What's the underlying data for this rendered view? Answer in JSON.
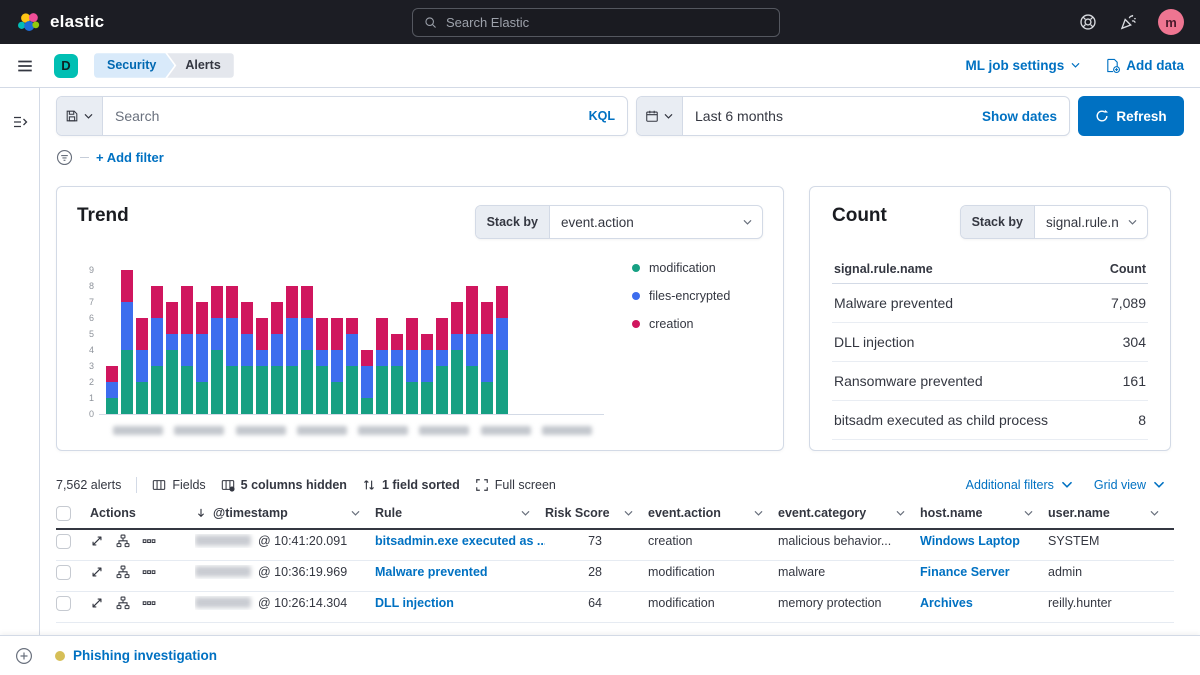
{
  "colors": {
    "primary": "#0071c2",
    "topbar_bg": "#1c1d24",
    "space_badge": "#00bfb3",
    "avatar_bg": "#ee7591",
    "timeline_dot": "#d6bf57",
    "header_underline": "#343741"
  },
  "topbar": {
    "brand": "elastic",
    "search_placeholder": "Search Elastic",
    "avatar_initial": "m"
  },
  "header": {
    "space_initial": "D",
    "breadcrumbs": [
      "Security",
      "Alerts"
    ],
    "ml_job_settings": "ML job settings",
    "add_data": "Add data"
  },
  "querybar": {
    "search_placeholder": "Search",
    "kql_label": "KQL",
    "date_range": "Last 6 months",
    "show_dates": "Show dates",
    "refresh_label": "Refresh",
    "add_filter_label": "+ Add filter"
  },
  "trend": {
    "title": "Trend",
    "stack_by_label": "Stack by",
    "stack_by_value": "event.action"
  },
  "count": {
    "title": "Count",
    "stack_by_label": "Stack by",
    "stack_by_value": "signal.rule.name",
    "table": {
      "field_header": "signal.rule.name",
      "count_header": "Count",
      "rows": [
        {
          "name": "Malware prevented",
          "count": "7,089"
        },
        {
          "name": "DLL injection",
          "count": "304"
        },
        {
          "name": "Ransomware prevented",
          "count": "161"
        },
        {
          "name": "bitsadm executed as child process",
          "count": "8"
        }
      ]
    }
  },
  "alerts": {
    "count": "7,562 alerts",
    "toolbar": {
      "fields": "Fields",
      "columns_hidden": "5 columns hidden",
      "field_sorted": "1 field sorted",
      "full_screen": "Full screen",
      "additional_filters": "Additional filters",
      "grid_view": "Grid view"
    },
    "columns": [
      "Actions",
      "@timestamp",
      "Rule",
      "Risk Score",
      "event.action",
      "event.category",
      "host.name",
      "user.name"
    ],
    "rows": [
      {
        "date_redacted": true,
        "time": "@ 10:41:20.091",
        "rule": "bitsadmin.exe executed as ...",
        "risk_score": "73",
        "event_action": "creation",
        "event_category": "malicious behavior...",
        "host": "Windows Laptop",
        "user": "SYSTEM"
      },
      {
        "date_redacted": true,
        "time": "@ 10:36:19.969",
        "rule": "Malware prevented",
        "risk_score": "28",
        "event_action": "modification",
        "event_category": "malware",
        "host": "Finance Server",
        "user": "admin"
      },
      {
        "date_redacted": true,
        "time": "@ 10:26:14.304",
        "rule": "DLL injection",
        "risk_score": "64",
        "event_action": "modification",
        "event_category": "memory protection",
        "host": "Archives",
        "user": "reilly.hunter"
      }
    ]
  },
  "timeline": {
    "label": "Phishing investigation"
  },
  "chart_data": {
    "type": "bar",
    "stacked": true,
    "title": "Trend",
    "stack_by": "event.action",
    "ylim": [
      0,
      9
    ],
    "y_ticks": [
      0,
      1,
      2,
      3,
      4,
      5,
      6,
      7,
      8,
      9
    ],
    "x_axis": {
      "labels_redacted": true,
      "tick_count": 8
    },
    "legend_position": "right",
    "series": [
      {
        "name": "modification",
        "color": "#16a083",
        "values": [
          1,
          4,
          2,
          3,
          4,
          3,
          2,
          4,
          3,
          3,
          3,
          3,
          3,
          4,
          3,
          2,
          3,
          1,
          3,
          3,
          2,
          2,
          3,
          4,
          3,
          2,
          4
        ]
      },
      {
        "name": "files-encrypted",
        "color": "#3d6dee",
        "values": [
          1,
          3,
          2,
          3,
          1,
          2,
          3,
          2,
          3,
          2,
          1,
          2,
          3,
          2,
          1,
          2,
          2,
          2,
          1,
          1,
          2,
          2,
          1,
          1,
          2,
          3,
          2
        ]
      },
      {
        "name": "creation",
        "color": "#d0165e",
        "values": [
          1,
          2,
          2,
          2,
          2,
          3,
          2,
          2,
          2,
          2,
          2,
          2,
          2,
          2,
          2,
          2,
          1,
          1,
          2,
          1,
          2,
          1,
          2,
          2,
          3,
          2,
          2
        ]
      }
    ]
  }
}
